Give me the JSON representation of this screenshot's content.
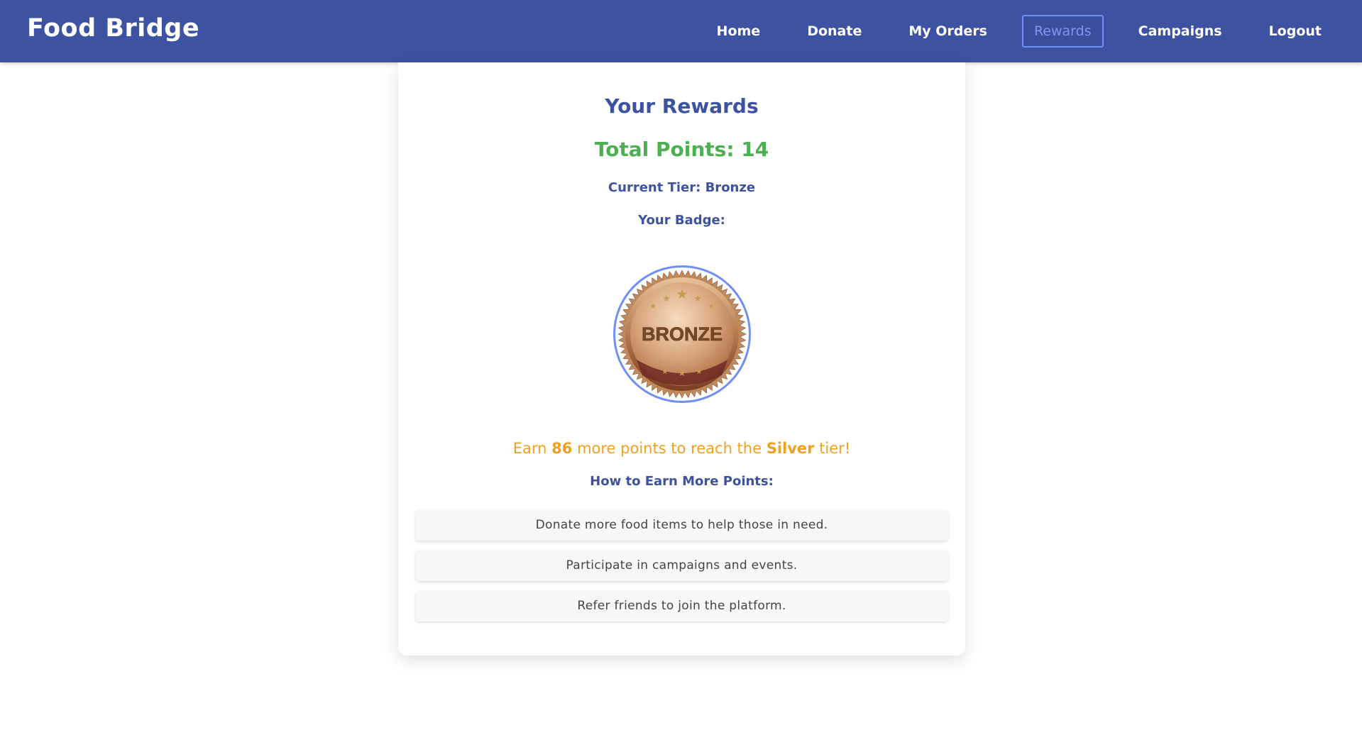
{
  "app": {
    "brand": "Food Bridge"
  },
  "nav": {
    "items": [
      {
        "label": "Home"
      },
      {
        "label": "Donate"
      },
      {
        "label": "My Orders"
      },
      {
        "label": "Rewards"
      },
      {
        "label": "Campaigns"
      },
      {
        "label": "Logout"
      }
    ],
    "active": "Rewards"
  },
  "rewards": {
    "title": "Your Rewards",
    "total_points_label": "Total Points: 14",
    "current_tier_label": "Current Tier: Bronze",
    "badge_label": "Your Badge:",
    "badge_text": "BRONZE",
    "earn": {
      "prefix": "Earn ",
      "points": "86",
      "middle": " more points to reach the ",
      "next_tier": "Silver",
      "suffix": " tier!"
    },
    "how_title": "How to Earn More Points:",
    "tips": [
      "Donate more food items to help those in need.",
      "Participate in campaigns and events.",
      "Refer friends to join the platform."
    ]
  },
  "colors": {
    "primary": "#3d52a0",
    "points_green": "#4caf50",
    "earn_orange": "#f0a020",
    "active_accent": "#6f8ff5"
  }
}
